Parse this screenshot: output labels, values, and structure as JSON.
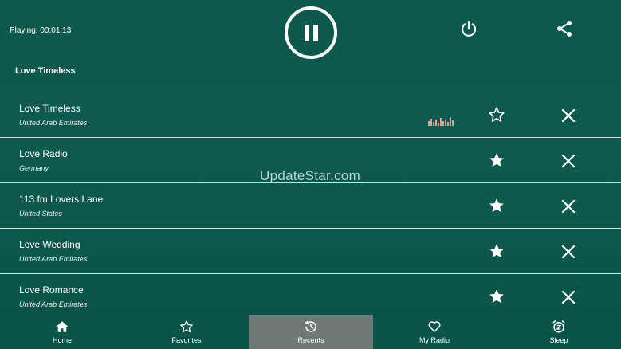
{
  "header": {
    "playing_label": "Playing: 00:01:13",
    "now_playing_title": "Love Timeless"
  },
  "stations": [
    {
      "name": "Love Timeless",
      "country": "United Arab Emirates",
      "favorite": false,
      "playing": true
    },
    {
      "name": "Love Radio",
      "country": "Germany",
      "favorite": true,
      "playing": false
    },
    {
      "name": "113.fm Lovers Lane",
      "country": "United States",
      "favorite": true,
      "playing": false
    },
    {
      "name": "Love Wedding",
      "country": "United Arab Emirates",
      "favorite": true,
      "playing": false
    },
    {
      "name": "Love Romance",
      "country": "United Arab Emirates",
      "favorite": true,
      "playing": false
    }
  ],
  "watermark": "UpdateStar.com",
  "nav": [
    {
      "label": "Home",
      "icon": "home-icon"
    },
    {
      "label": "Favorites",
      "icon": "star-icon"
    },
    {
      "label": "Recents",
      "icon": "history-icon",
      "active": true
    },
    {
      "label": "My Radio",
      "icon": "heart-icon"
    },
    {
      "label": "Sleep",
      "icon": "alarm-icon"
    }
  ],
  "colors": {
    "background": "#0d594c",
    "active_tab": "#6f7a78",
    "equalizer": "#e0a58f"
  }
}
